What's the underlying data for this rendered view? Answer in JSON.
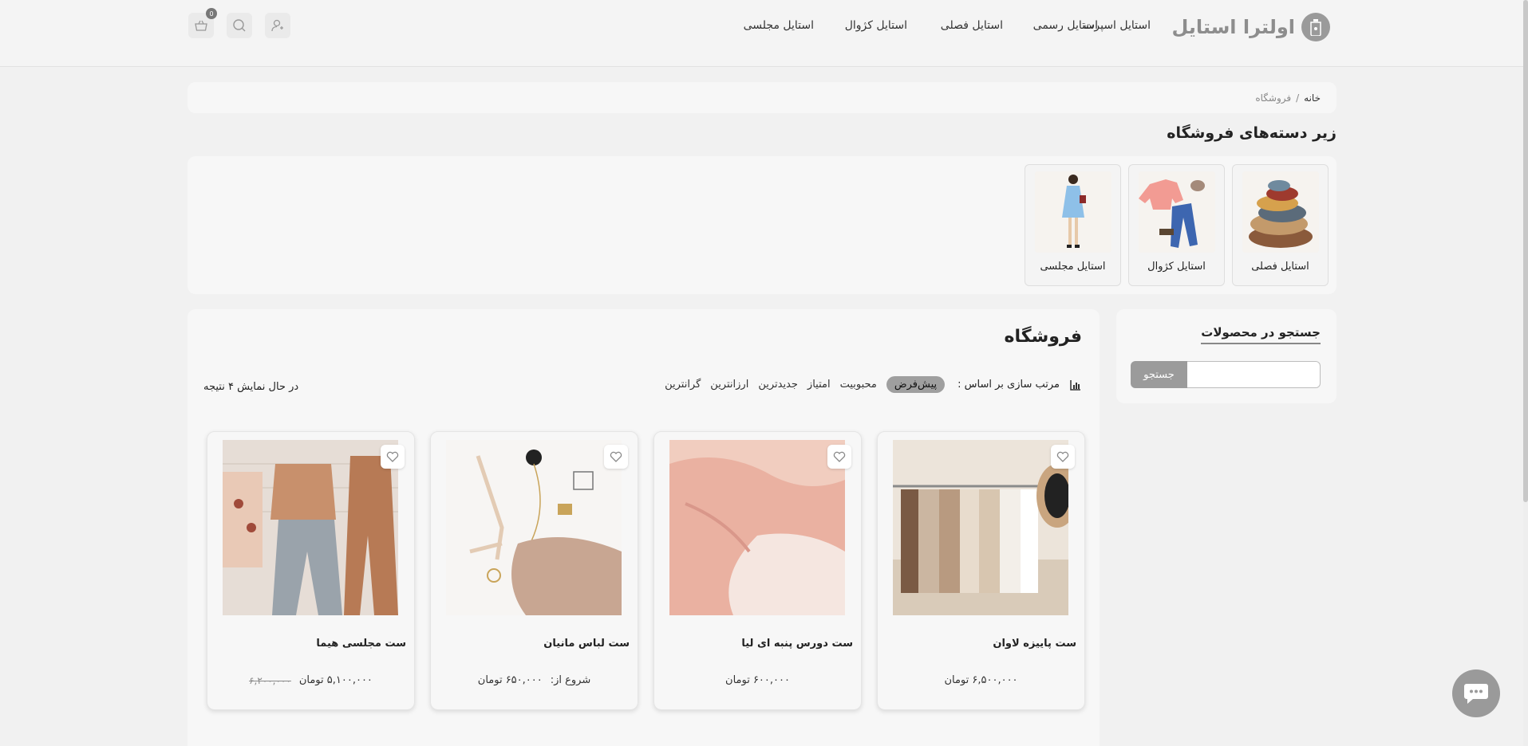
{
  "header": {
    "logo_text": "اولترا استایل",
    "nav": [
      {
        "label": "استایل اسپرت"
      },
      {
        "label": "استایل رسمی"
      },
      {
        "label": "استایل فصلی"
      },
      {
        "label": "استایل کژوال"
      },
      {
        "label": "استایل مجلسی"
      }
    ],
    "cart_count": "0"
  },
  "breadcrumb": {
    "home": "خانه",
    "separator": "/",
    "current": "فروشگاه"
  },
  "subcategories": {
    "title": "زیر دسته‌های فروشگاه",
    "items": [
      {
        "label": "استایل فصلی"
      },
      {
        "label": "استایل کژوال"
      },
      {
        "label": "استایل مجلسی"
      }
    ]
  },
  "sidebar": {
    "title": "جستجو در محصولات",
    "search_placeholder": "",
    "search_button": "جستجو"
  },
  "shop": {
    "title": "فروشگاه",
    "sort_label": "مرتب سازی بر اساس :",
    "sort_options": [
      {
        "label": "پیش‌فرض",
        "active": true
      },
      {
        "label": "محبوبیت"
      },
      {
        "label": "امتیاز"
      },
      {
        "label": "جدیدترین"
      },
      {
        "label": "ارزانترین"
      },
      {
        "label": "گرانترین"
      }
    ],
    "result_count": "در حال نمایش ۴ نتیجه",
    "products": [
      {
        "name": "ست پاییزه لاوان",
        "price": "۶,۵۰۰,۰۰۰ تومان"
      },
      {
        "name": "ست دورس پنبه ای لیا",
        "price": "۶۰۰,۰۰۰ تومان"
      },
      {
        "name": "ست لباس مانیان",
        "from": "شروع از:",
        "price": "۶۵۰,۰۰۰ تومان"
      },
      {
        "name": "ست مجلسی هیما",
        "old_price": "۶,۲۰۰,۰۰۰",
        "price": "۵,۱۰۰,۰۰۰ تومان"
      }
    ]
  },
  "colors": {
    "accent_gray": "#9a9a9a",
    "background": "#f1f1f1"
  }
}
